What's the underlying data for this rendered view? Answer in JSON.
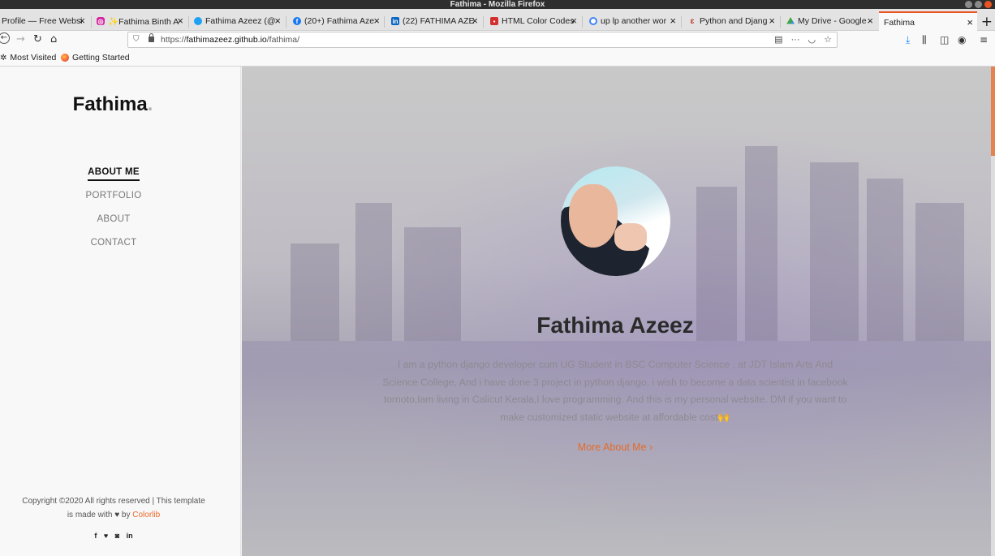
{
  "window": {
    "title": "Fathima - Mozilla Firefox"
  },
  "tabs": [
    {
      "label": "Profile — Free Websi",
      "icon": "page-icon",
      "color": "#cccccc"
    },
    {
      "label": "✨Fathima Binth A",
      "icon": "instagram-icon",
      "color": "#d6249f"
    },
    {
      "label": "Fathima Azeez (@",
      "icon": "twitter-icon",
      "color": "#1da1f2"
    },
    {
      "label": "(20+) Fathima Aze",
      "icon": "facebook-icon",
      "color": "#1877f2"
    },
    {
      "label": "(22) FATHIMA AZE",
      "icon": "linkedin-icon",
      "color": "#0a66c2"
    },
    {
      "label": "HTML Color Codes",
      "icon": "color-codes-icon",
      "color": "#d32f2f"
    },
    {
      "label": "up lp another wor",
      "icon": "google-icon",
      "color": "#4285f4"
    },
    {
      "label": "Python and Djang",
      "icon": "django-icon",
      "color": "#c0392b"
    },
    {
      "label": "My Drive - Google",
      "icon": "drive-icon",
      "color": "#fbbc04"
    },
    {
      "label": "Fathima",
      "icon": "none",
      "color": "#ffffff"
    }
  ],
  "navbar": {
    "url_prefix": "https://",
    "url_domain": "fathimazeez.github.io",
    "url_path": "/fathima/"
  },
  "bookmarks": [
    {
      "label": "Most Visited",
      "icon": "gear-icon"
    },
    {
      "label": "Getting Started",
      "icon": "firefox-icon"
    }
  ],
  "sidebar": {
    "logo": "Fathima",
    "logo_dot": ".",
    "menu": [
      {
        "label": "ABOUT ME",
        "active": true
      },
      {
        "label": "PORTFOLIO",
        "active": false
      },
      {
        "label": "ABOUT",
        "active": false
      },
      {
        "label": "CONTACT",
        "active": false
      }
    ],
    "copyright_line1": "Copyright ©2020 All rights reserved | This template",
    "copyright_line2_prefix": "is made with",
    "copyright_line2_by": "by",
    "copyright_link": "Colorlib",
    "social": [
      "f",
      "t",
      "ig",
      "in"
    ]
  },
  "hero": {
    "name": "Fathima Azeez",
    "bio": "I am a python django developer cum UG Student in BSC Computer Science , at JDT Islam Arts And Science College, And i have done 3 project in python django, i wish to become a data scientist in facebook tornoto,Iam living in Calicut Kerala,I love programming. And this is my personal website. DM if you want to make customized static website at affordable cost🙌",
    "more_link": "More About Me",
    "more_chevron": "›"
  },
  "colors": {
    "accent": "#e96b2c",
    "active_tab_border": "#e95420"
  }
}
